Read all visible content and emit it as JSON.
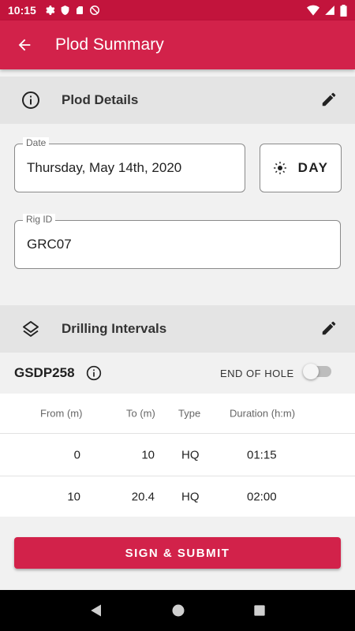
{
  "status_bar": {
    "time": "10:15"
  },
  "app_bar": {
    "title": "Plod Summary"
  },
  "plod_details": {
    "header": "Plod Details",
    "date_label": "Date",
    "date_value": "Thursday, May 14th, 2020",
    "shift": "DAY",
    "rig_label": "Rig ID",
    "rig_value": "GRC07"
  },
  "drilling_intervals": {
    "header": "Drilling Intervals",
    "hole_id": "GSDP258",
    "end_of_hole_label": "END OF HOLE",
    "end_of_hole_on": false,
    "columns": [
      "From (m)",
      "To (m)",
      "Type",
      "Duration (h:m)"
    ],
    "rows": [
      {
        "from": "0",
        "to": "10",
        "type": "HQ",
        "duration": "01:15"
      },
      {
        "from": "10",
        "to": "20.4",
        "type": "HQ",
        "duration": "02:00"
      }
    ]
  },
  "submit_label": "SIGN & SUBMIT",
  "colors": {
    "primary": "#d2224a",
    "status_bar": "#c2143c"
  }
}
